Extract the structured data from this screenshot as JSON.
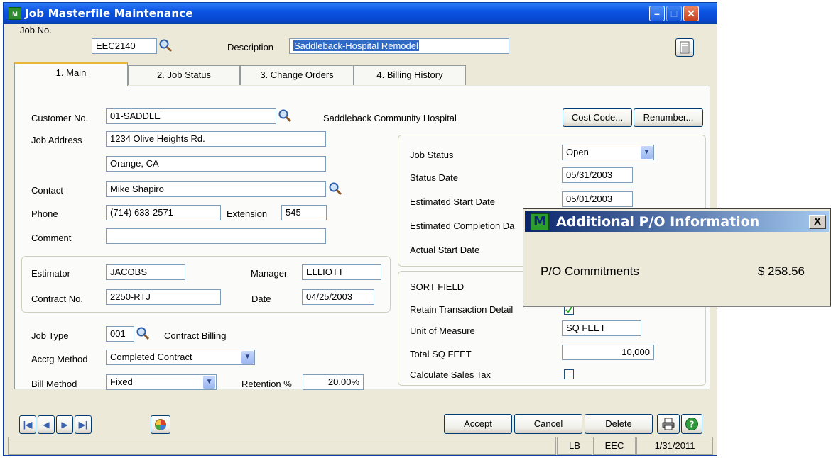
{
  "window": {
    "title": "Job Masterfile Maintenance",
    "app_icon": "M"
  },
  "header": {
    "job_no_label": "Job No.",
    "job_no_value": "EEC2140",
    "description_label": "Description",
    "description_value": "Saddleback-Hospital Remodel"
  },
  "tabs": [
    {
      "label": "1. Main"
    },
    {
      "label": "2. Job Status"
    },
    {
      "label": "3. Change Orders"
    },
    {
      "label": "4. Billing History"
    }
  ],
  "main": {
    "customer_no_label": "Customer No.",
    "customer_no_value": "01-SADDLE",
    "customer_name": "Saddleback Community Hospital",
    "cost_code_button": "Cost Code...",
    "renumber_button": "Renumber...",
    "job_address_label": "Job Address",
    "address1": "1234 Olive Heights Rd.",
    "address2": "Orange, CA",
    "contact_label": "Contact",
    "contact_value": "Mike Shapiro",
    "phone_label": "Phone",
    "phone_value": "(714) 633-2571",
    "extension_label": "Extension",
    "extension_value": "545",
    "comment_label": "Comment",
    "comment_value": "",
    "estimator_label": "Estimator",
    "estimator_value": "JACOBS",
    "manager_label": "Manager",
    "manager_value": "ELLIOTT",
    "contract_no_label": "Contract No.",
    "contract_no_value": "2250-RTJ",
    "date_label": "Date",
    "date_value": "04/25/2003",
    "job_type_label": "Job Type",
    "job_type_value": "001",
    "job_type_desc": "Contract Billing",
    "acctg_method_label": "Acctg Method",
    "acctg_method_value": "Completed Contract",
    "bill_method_label": "Bill Method",
    "bill_method_value": "Fixed",
    "retention_label": "Retention %",
    "retention_value": "20.00%"
  },
  "status_group": {
    "job_status_label": "Job Status",
    "job_status_value": "Open",
    "status_date_label": "Status Date",
    "status_date_value": "05/31/2003",
    "est_start_label": "Estimated Start Date",
    "est_start_value": "05/01/2003",
    "est_completion_label": "Estimated Completion Da",
    "actual_start_label": "Actual Start Date"
  },
  "sort_group": {
    "sort_field_label": "SORT FIELD",
    "retain_label": "Retain Transaction Detail",
    "retain_checked": true,
    "uom_label": "Unit of Measure",
    "uom_value": "SQ FEET",
    "total_label": "Total SQ FEET",
    "total_value": "10,000",
    "calc_tax_label": "Calculate Sales Tax",
    "calc_tax_checked": false
  },
  "buttons": {
    "accept": "Accept",
    "cancel": "Cancel",
    "delete": "Delete"
  },
  "status_bar": {
    "user": "LB",
    "company": "EEC",
    "date": "1/31/2011"
  },
  "popup": {
    "title": "Additional P/O Information",
    "close": "X",
    "po_label": "P/O Commitments",
    "po_value": "$ 258.56",
    "icon": "M"
  },
  "icons": [
    "search-icon",
    "notes-icon",
    "first-record-icon",
    "previous-record-icon",
    "next-record-icon",
    "last-record-icon",
    "lookup-wheel-icon",
    "print-icon",
    "help-icon",
    "chevron-down-icon",
    "checkmark-icon",
    "minimize-icon",
    "maximize-icon",
    "close-icon"
  ],
  "colors": {
    "title_bar": "#0a54e3",
    "window_bg": "#ece9d8",
    "selection": "#316ac5",
    "popup_title": "#0a246a"
  }
}
